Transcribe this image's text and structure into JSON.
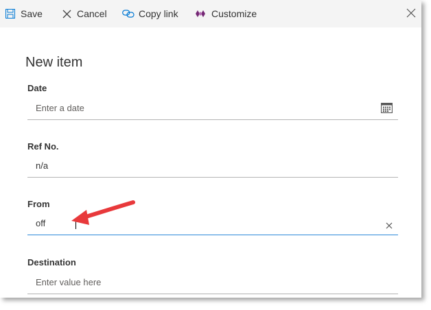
{
  "toolbar": {
    "save_label": "Save",
    "cancel_label": "Cancel",
    "copy_link_label": "Copy link",
    "customize_label": "Customize"
  },
  "form": {
    "title": "New item",
    "fields": {
      "date": {
        "label": "Date",
        "placeholder": "Enter a date",
        "value": ""
      },
      "ref_no": {
        "label": "Ref No.",
        "placeholder": "",
        "value": "n/a"
      },
      "from": {
        "label": "From",
        "placeholder": "",
        "value": "off"
      },
      "destination": {
        "label": "Destination",
        "placeholder": "Enter value here",
        "value": ""
      }
    }
  },
  "colors": {
    "accent": "#2b88d8",
    "customize_icon": "#742774",
    "annotation_arrow": "#e8393b"
  },
  "icons": {
    "save": "save-icon",
    "cancel": "cancel-icon",
    "copy_link": "link-icon",
    "customize": "customize-icon",
    "close": "close-icon",
    "calendar": "calendar-icon",
    "clear": "clear-icon"
  }
}
